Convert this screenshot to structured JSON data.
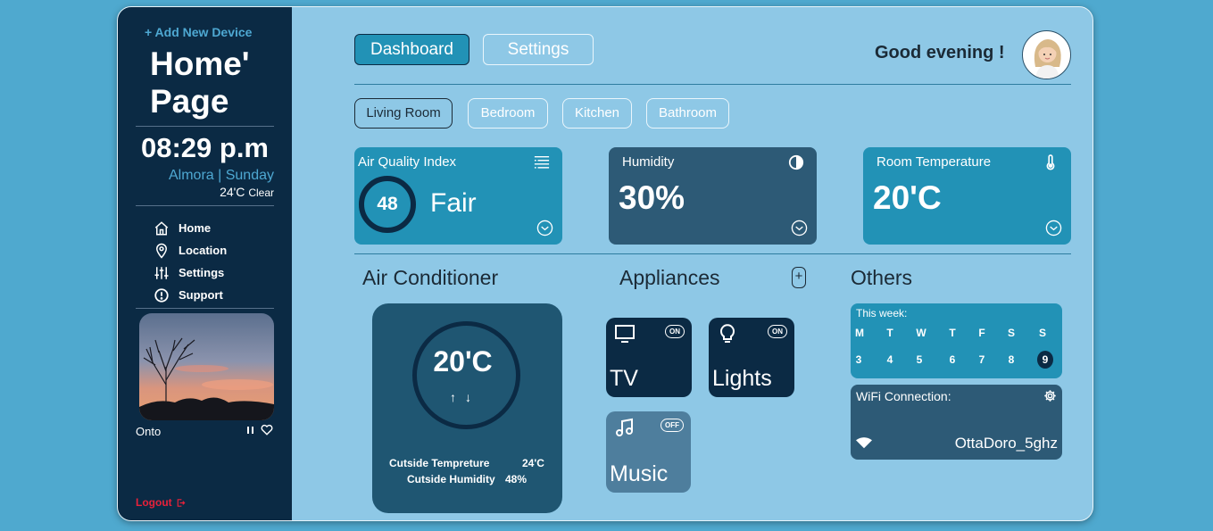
{
  "sidebar": {
    "add_device": "+ Add New Device",
    "title_line1": "Home'",
    "title_line2": "Page",
    "time": "08:29 p.m",
    "location": "Almora | Sunday",
    "temperature": "24'C",
    "condition": "Clear",
    "nav": [
      {
        "label": "Home",
        "icon": "home-icon"
      },
      {
        "label": "Location",
        "icon": "location-pin-icon"
      },
      {
        "label": "Settings",
        "icon": "sliders-icon"
      },
      {
        "label": "Support",
        "icon": "alert-circle-icon"
      }
    ],
    "song_title": "Onto",
    "logout": "Logout"
  },
  "header": {
    "tabs": [
      {
        "label": "Dashboard",
        "active": true
      },
      {
        "label": "Settings",
        "active": false
      }
    ],
    "greeting": "Good evening !"
  },
  "rooms": [
    {
      "label": "Living Room",
      "active": true
    },
    {
      "label": "Bedroom",
      "active": false
    },
    {
      "label": "Kitchen",
      "active": false
    },
    {
      "label": "Bathroom",
      "active": false
    }
  ],
  "cards": {
    "aqi": {
      "title": "Air Quality Index",
      "value": "48",
      "status": "Fair",
      "icon": "list-filter-icon"
    },
    "humidity": {
      "title": "Humidity",
      "value": "30%",
      "icon": "half-drop-icon"
    },
    "room_temp": {
      "title": "Room Temperature",
      "value": "20'C",
      "icon": "thermometer-icon"
    }
  },
  "sections": {
    "ac": "Air Conditioner",
    "appliances": "Appliances",
    "others": "Others"
  },
  "ac": {
    "temperature": "20'C",
    "outside_temp_label": "Cutside Tempreture",
    "outside_temp_value": "24'C",
    "outside_hum_label": "Cutside Humidity",
    "outside_hum_value": "48%"
  },
  "appliances": {
    "add": "+",
    "items": [
      {
        "label": "TV",
        "state": "ON",
        "icon": "monitor-icon"
      },
      {
        "label": "Lights",
        "state": "ON",
        "icon": "lightbulb-icon"
      },
      {
        "label": "Music",
        "state": "OFF",
        "icon": "music-note-icon"
      }
    ]
  },
  "week": {
    "title": "This week:",
    "days": [
      "M",
      "T",
      "W",
      "T",
      "F",
      "S",
      "S"
    ],
    "dates": [
      "3",
      "4",
      "5",
      "6",
      "7",
      "8",
      "9"
    ],
    "today": "9"
  },
  "wifi": {
    "title": "WiFi Connection:",
    "ssid": "OttaDoro_5ghz"
  },
  "colors": {
    "sidebar_bg": "#0b2a44",
    "main_bg": "#8ec8e6",
    "accent": "#2292b6",
    "card_dark": "#2d5a76",
    "logout": "#e8213a"
  }
}
